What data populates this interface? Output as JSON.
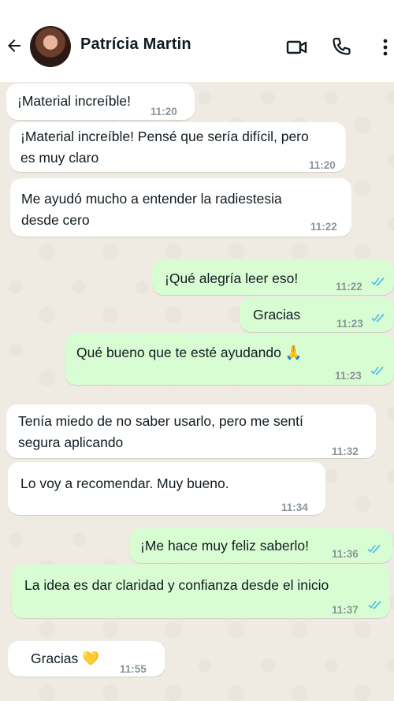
{
  "header": {
    "contact_name": "Patrícia Martin",
    "icons": [
      "back-arrow-icon",
      "video-call-icon",
      "phone-icon",
      "more-vertical-icon"
    ]
  },
  "colors": {
    "incoming_bubble": "#ffffff",
    "outgoing_bubble": "#d9fdd3",
    "read_ticks": "#53bdeb",
    "timestamp": "#8a9499"
  },
  "messages": [
    {
      "dir": "in",
      "lines": [
        "¡Material increíble!"
      ],
      "time": "11:20"
    },
    {
      "dir": "in",
      "lines": [
        "¡Material increíble! Pensé que sería difícil, pero",
        "es muy claro"
      ],
      "time": "11:20"
    },
    {
      "dir": "in",
      "lines": [
        "Me ayudó mucho a entender la radiestesia",
        "desde cero"
      ],
      "time": "11:22"
    },
    {
      "dir": "out",
      "lines": [
        "¡Qué alegría leer eso!"
      ],
      "time": "11:22"
    },
    {
      "dir": "out",
      "lines": [
        "Gracias"
      ],
      "time": "11:23"
    },
    {
      "dir": "out",
      "lines": [
        "Qué bueno que te esté ayudando 🙏"
      ],
      "time": "11:23"
    },
    {
      "dir": "in",
      "lines": [
        "Tenía miedo de no saber usarlo, pero me sentí",
        "segura aplicando"
      ],
      "time": "11:32"
    },
    {
      "dir": "in",
      "lines": [
        "Lo voy a recomendar. Muy bueno."
      ],
      "time": "11:34"
    },
    {
      "dir": "out",
      "lines": [
        "¡Me hace muy feliz saberlo!"
      ],
      "time": "11:36"
    },
    {
      "dir": "out",
      "lines": [
        "La idea es dar claridad y confianza desde el inicio"
      ],
      "time": "11:37"
    },
    {
      "dir": "in",
      "lines": [
        "Gracias 💛"
      ],
      "time": "11:55"
    }
  ]
}
